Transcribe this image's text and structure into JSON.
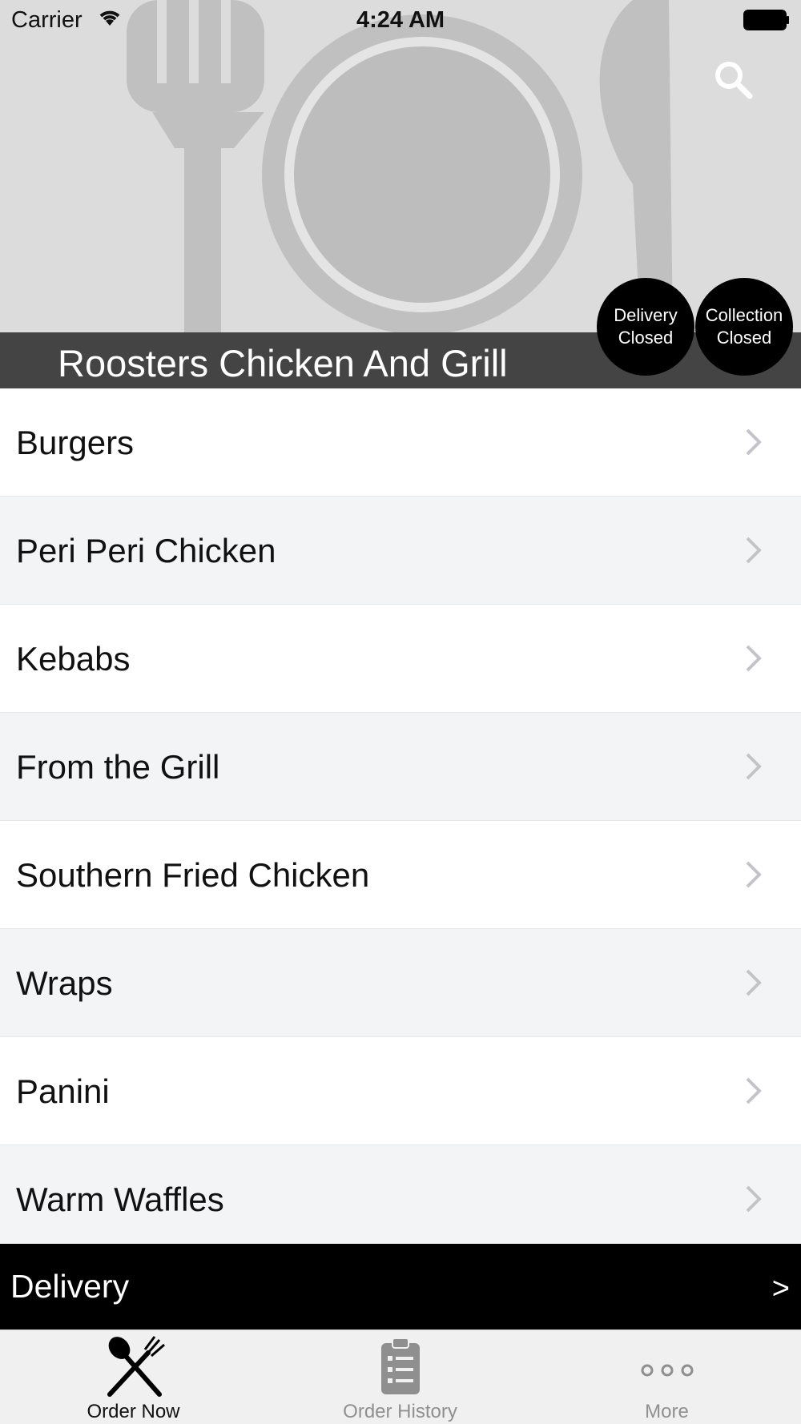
{
  "status_bar": {
    "carrier": "Carrier",
    "time": "4:24 AM"
  },
  "header": {
    "restaurant_name": "Roosters Chicken And Grill",
    "search_icon": "search-icon",
    "background_icon": "fork-plate-knife-illustration"
  },
  "badges": {
    "delivery": {
      "line1": "Delivery",
      "line2": "Closed"
    },
    "collection": {
      "line1": "Collection",
      "line2": "Closed"
    }
  },
  "menu": {
    "items": [
      {
        "label": "Burgers"
      },
      {
        "label": "Peri Peri Chicken"
      },
      {
        "label": "Kebabs"
      },
      {
        "label": "From the Grill"
      },
      {
        "label": "Southern Fried Chicken"
      },
      {
        "label": "Wraps"
      },
      {
        "label": "Panini"
      },
      {
        "label": "Warm Waffles"
      }
    ]
  },
  "delivery_bar": {
    "label": "Delivery",
    "arrow": ">"
  },
  "tabs": [
    {
      "label": "Order Now",
      "icon": "fork-knife-icon",
      "active": true
    },
    {
      "label": "Order History",
      "icon": "clipboard-icon",
      "active": false
    },
    {
      "label": "More",
      "icon": "more-dots-icon",
      "active": false
    }
  ],
  "colors": {
    "title_bar": "#444444",
    "badge": "#000000",
    "row_alt": "#f3f4f6",
    "delivery_bar": "#000000",
    "tab_active": "#111111",
    "tab_inactive": "#909090"
  }
}
